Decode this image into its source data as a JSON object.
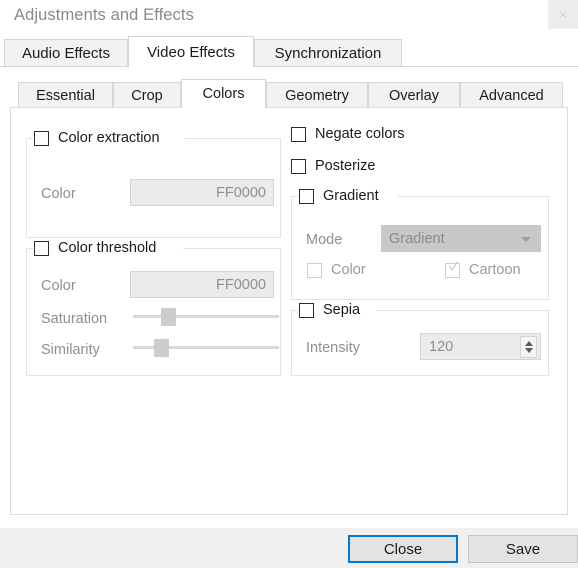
{
  "window": {
    "title": "Adjustments and Effects",
    "close_icon": "close-icon",
    "close_glyph": "✕"
  },
  "accent_color": "#0078d7",
  "outer_tabs": [
    {
      "label": "Audio Effects",
      "active": false
    },
    {
      "label": "Video Effects",
      "active": true
    },
    {
      "label": "Synchronization",
      "active": false
    }
  ],
  "inner_tabs": [
    {
      "label": "Essential",
      "active": false
    },
    {
      "label": "Crop",
      "active": false
    },
    {
      "label": "Colors",
      "active": true
    },
    {
      "label": "Geometry",
      "active": false
    },
    {
      "label": "Overlay",
      "active": false
    },
    {
      "label": "Advanced",
      "active": false
    }
  ],
  "color_extraction": {
    "title": "Color extraction",
    "checked": false,
    "color_label": "Color",
    "color_value": "FF0000"
  },
  "color_threshold": {
    "title": "Color threshold",
    "checked": false,
    "color_label": "Color",
    "color_value": "FF0000",
    "saturation_label": "Saturation",
    "similarity_label": "Similarity"
  },
  "negate_colors": {
    "label": "Negate colors",
    "checked": false
  },
  "posterize": {
    "label": "Posterize",
    "checked": false
  },
  "gradient": {
    "title": "Gradient",
    "checked": false,
    "mode_label": "Mode",
    "mode_value": "Gradient",
    "color_label": "Color",
    "color_checked": false,
    "cartoon_label": "Cartoon",
    "cartoon_checked": true
  },
  "sepia": {
    "title": "Sepia",
    "checked": false,
    "intensity_label": "Intensity",
    "intensity_value": "120"
  },
  "footer": {
    "close_label": "Close",
    "save_label": "Save"
  }
}
